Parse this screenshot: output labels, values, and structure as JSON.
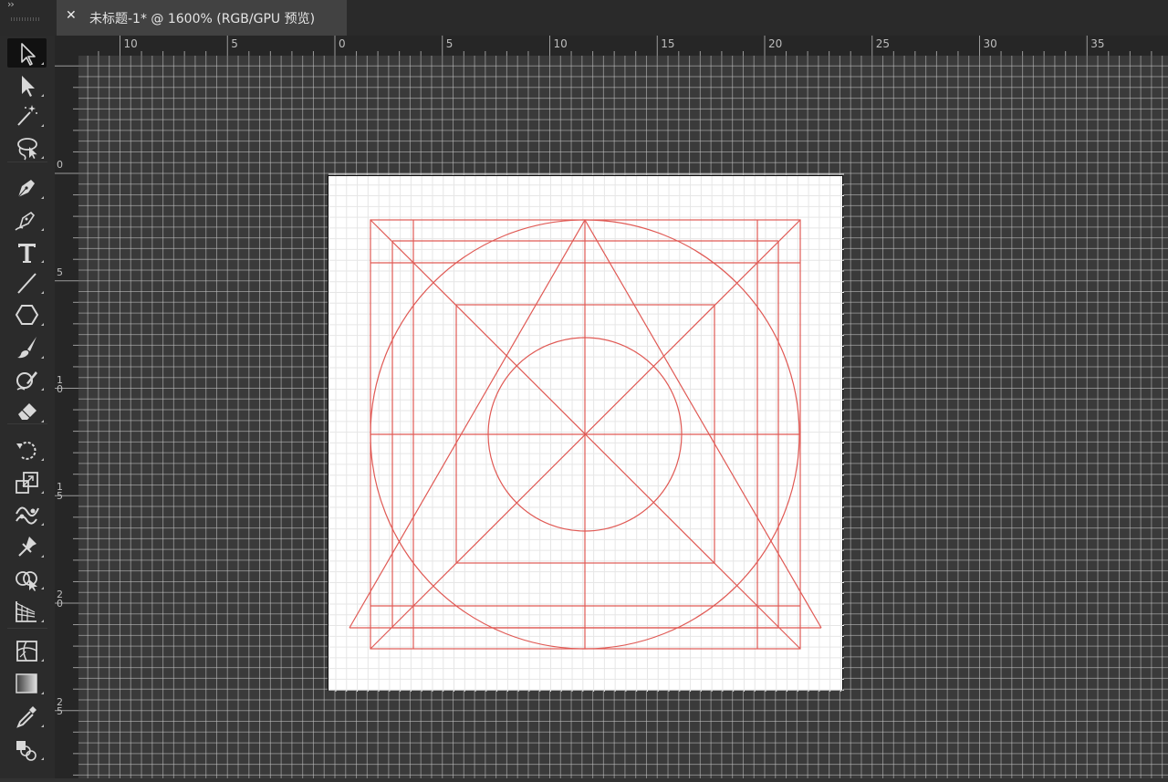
{
  "tab": {
    "close_glyph": "✕",
    "title": "未标题-1* @ 1600% (RGB/GPU 预览)"
  },
  "panel": {
    "collapse_glyph": "››"
  },
  "tools": [
    {
      "name": "selection-tool",
      "icon": "arrow-icon",
      "active": true
    },
    {
      "name": "direct-selection-tool",
      "icon": "direct-arrow-icon"
    },
    {
      "name": "magic-wand-tool",
      "icon": "magic-wand-icon"
    },
    {
      "name": "lasso-tool",
      "icon": "lasso-icon"
    },
    {
      "name": "pen-tool",
      "icon": "pen-icon"
    },
    {
      "name": "curvature-tool",
      "icon": "curvature-pen-icon"
    },
    {
      "name": "type-tool",
      "icon": "type-icon"
    },
    {
      "name": "line-segment-tool",
      "icon": "line-icon"
    },
    {
      "name": "polygon-tool",
      "icon": "hexagon-icon"
    },
    {
      "name": "paintbrush-tool",
      "icon": "brush-icon"
    },
    {
      "name": "shaper-tool",
      "icon": "shaper-icon"
    },
    {
      "name": "eraser-tool",
      "icon": "eraser-icon"
    },
    {
      "name": "rotate-tool",
      "icon": "rotate-icon"
    },
    {
      "name": "scale-tool",
      "icon": "scale-icon"
    },
    {
      "name": "puppet-warp-tool",
      "icon": "puppet-warp-icon"
    },
    {
      "name": "pin-tool",
      "icon": "pin-icon"
    },
    {
      "name": "shape-builder-tool",
      "icon": "shape-builder-icon"
    },
    {
      "name": "perspective-grid-tool",
      "icon": "perspective-grid-icon"
    },
    {
      "name": "mesh-tool",
      "icon": "mesh-icon"
    },
    {
      "name": "gradient-tool",
      "icon": "gradient-icon"
    },
    {
      "name": "eyedropper-tool",
      "icon": "eyedropper-icon"
    },
    {
      "name": "blend-tool",
      "icon": "blend-icon"
    }
  ],
  "rulers": {
    "horizontal": [
      "10",
      "5",
      "0",
      "5",
      "10",
      "15",
      "20",
      "25",
      "30",
      "35"
    ],
    "vertical": [
      "0",
      "5",
      "10",
      "15",
      "20",
      "25"
    ]
  },
  "colors": {
    "canvas_bg": "#3a3a3a",
    "canvas_grid": "#c8c8c8",
    "artboard_bg": "#ffffff",
    "artboard_grid": "#e6e6e6",
    "guide_stroke": "#e05a55"
  }
}
